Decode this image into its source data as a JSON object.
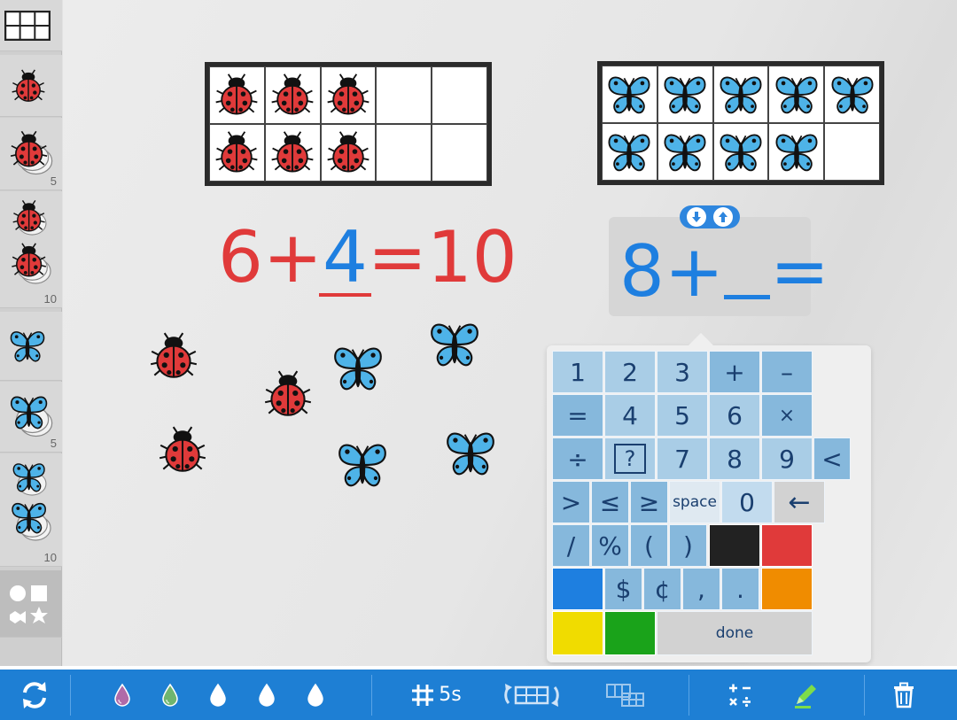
{
  "sidebar": {
    "items": [
      {
        "id": "tenframe",
        "icon": "grid-icon",
        "count": ""
      },
      {
        "id": "ladybug-1",
        "icon": "ladybug-icon",
        "count": ""
      },
      {
        "id": "ladybug-5",
        "icon": "ladybug-stack-icon",
        "count": "5"
      },
      {
        "id": "ladybug-10",
        "icon": "ladybug-stack-icon",
        "count": "10"
      },
      {
        "id": "butterfly-1",
        "icon": "butterfly-icon",
        "count": ""
      },
      {
        "id": "butterfly-5",
        "icon": "butterfly-stack-icon",
        "count": "5"
      },
      {
        "id": "butterfly-10",
        "icon": "butterfly-stack-icon",
        "count": "10"
      },
      {
        "id": "shapes",
        "icon": "shapes-icon",
        "count": ""
      }
    ]
  },
  "ten_frames": [
    {
      "counter": "ladybug",
      "filled": 6
    },
    {
      "counter": "butterfly",
      "filled": 9
    }
  ],
  "equations": {
    "left": {
      "a": "6",
      "op": "+",
      "b": "4",
      "eq": "=",
      "result": "10"
    },
    "right": {
      "a": "8",
      "op": "+",
      "eq": "="
    }
  },
  "loose_counters": {
    "ladybugs": 3,
    "butterflies": 4
  },
  "keypad": {
    "keys": {
      "k1": "1",
      "k2": "2",
      "k3": "3",
      "plus": "+",
      "minus": "–",
      "equals": "=",
      "k4": "4",
      "k5": "5",
      "k6": "6",
      "times": "×",
      "divide": "÷",
      "unknown": "?",
      "k7": "7",
      "k8": "8",
      "k9": "9",
      "lt": "<",
      "gt": ">",
      "le": "≤",
      "ge": "≥",
      "space": "space",
      "k0": "0",
      "backspace": "←",
      "slash": "/",
      "percent": "%",
      "lparen": "(",
      "rparen": ")",
      "dollar": "$",
      "cent": "¢",
      "comma": ",",
      "period": ".",
      "done": "done"
    },
    "colors": {
      "black": "#222222",
      "red": "#e03a3a",
      "blue": "#1e7fe0",
      "orange": "#f08c00",
      "yellow": "#f0dc00",
      "green": "#1aa31a"
    }
  },
  "toolbar": {
    "reset_icon": "refresh-icon",
    "drops": [
      "#b06aa8",
      "#6fb56f",
      "#ffffff",
      "#ffffff",
      "#ffffff"
    ],
    "grid_size_label": "5s",
    "accent": "#1e7fd4"
  }
}
